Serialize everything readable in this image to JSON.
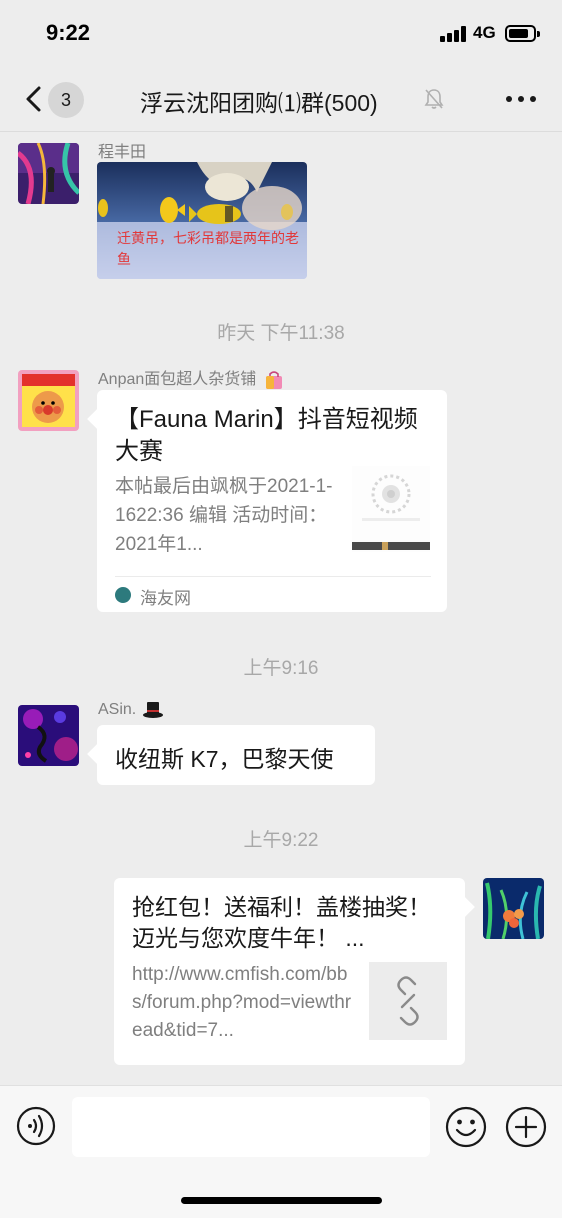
{
  "status_bar": {
    "time": "9:22",
    "network": "4G"
  },
  "nav": {
    "unread_count": "3",
    "title": "浮云沈阳团购⑴群(500)"
  },
  "messages": {
    "m1": {
      "sender": "程丰田",
      "image_caption": "迁黄吊，七彩吊都是两年的老鱼"
    },
    "sep1": "昨天 下午11:38",
    "m2": {
      "sender": "Anpan面包超人杂货铺",
      "card_title": "【Fauna Marin】抖音短视频大赛",
      "card_desc": "本帖最后由飒枫于2021-1-1622:36 编辑 活动时间：2021年1...",
      "card_source": "海友网"
    },
    "sep2": "上午9:16",
    "m3": {
      "sender": "ASin.",
      "text": "收纽斯 K7，巴黎天使"
    },
    "sep3": "上午9:22",
    "m4": {
      "link_title": "抢红包！送福利！盖楼抽奖！迈光与您欢度牛年！ ...",
      "link_url": "http://www.cmfish.com/bbs/forum.php?mod=viewthread&tid=7..."
    }
  },
  "icons": {
    "back": "chevron-left-icon",
    "mute": "bell-slash-icon",
    "more": "more-icon",
    "voice": "voice-icon",
    "emoji": "emoji-icon",
    "plus": "plus-icon",
    "link": "link-icon",
    "shop_bag": "shopping-bag-icon",
    "top_hat": "top-hat-icon"
  }
}
